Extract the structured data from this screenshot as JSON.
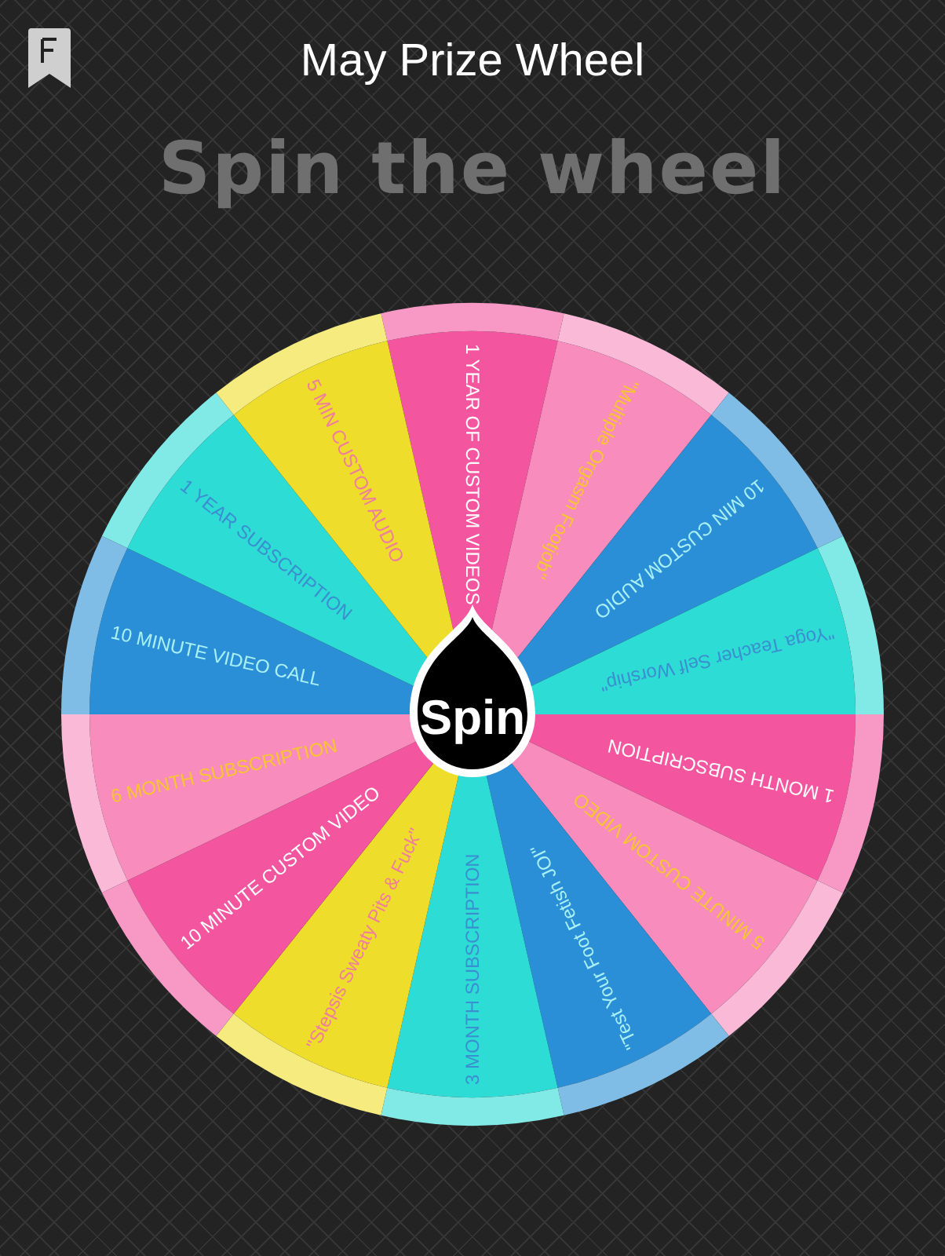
{
  "app_bar": {
    "title": "May Prize Wheel"
  },
  "heading": "Spin the wheel",
  "wheel": {
    "spin_button": "Spin",
    "segments": [
      {
        "label": "1 YEAR OF CUSTOM VIDEOS",
        "color": "#f4559f"
      },
      {
        "label": "\"Multiple Orgasm Footjob\"",
        "color": "#f78cbd"
      },
      {
        "label": "10 MIN CUSTOM AUDIO",
        "color": "#2a8fd6"
      },
      {
        "label": "\"Yoga Teacher Self Worship\"",
        "color": "#2ddcd5"
      },
      {
        "label": "1 MONTH SUBSCRIPTION",
        "color": "#f4559f"
      },
      {
        "label": "5 MINUTE CUSTOM VIDEO",
        "color": "#f78cbd"
      },
      {
        "label": "\"Test Your Foot Fetish JOI\"",
        "color": "#2a8fd6"
      },
      {
        "label": "3 MONTH SUBSCRIPTION",
        "color": "#2ddcd5"
      },
      {
        "label": "\"Stepsis Sweaty Pits & Fuck\"",
        "color": "#eedd2a"
      },
      {
        "label": "10 MINUTE CUSTOM VIDEO",
        "color": "#f4559f"
      },
      {
        "label": "6 MONTH SUBSCRIPTION",
        "color": "#f78cbd"
      },
      {
        "label": "10 MINUTE VIDEO CALL",
        "color": "#2a8fd6"
      },
      {
        "label": "1 YEAR SUBSCRIPTION",
        "color": "#2ddcd5"
      },
      {
        "label": "5 MIN CUSTOM AUDIO",
        "color": "#eedd2a"
      }
    ]
  }
}
